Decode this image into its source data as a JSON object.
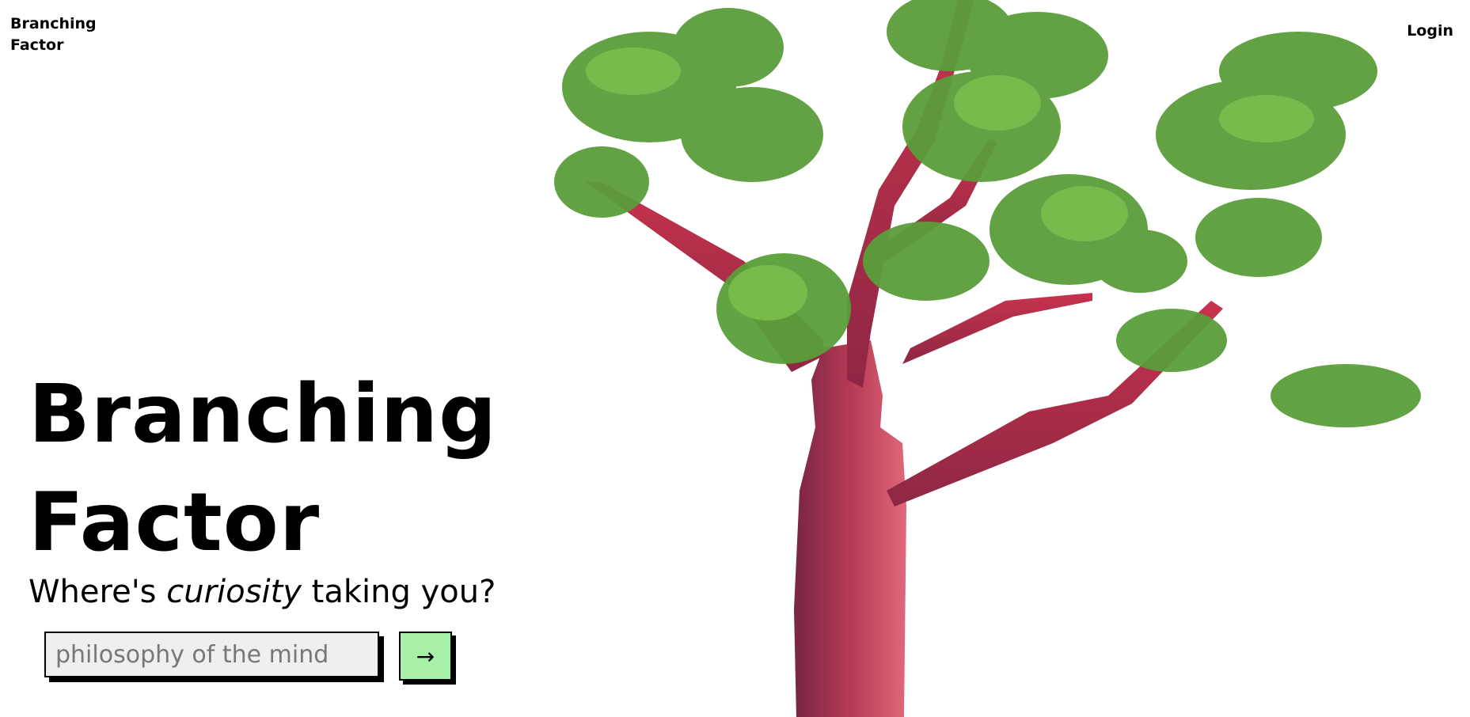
{
  "header": {
    "logo": "Branching\nFactor",
    "login_label": "Login"
  },
  "hero": {
    "title_line1": "Branching",
    "title_line2": "Factor",
    "tagline_before": "Where's ",
    "tagline_emphasis": "curiosity",
    "tagline_after": " taking you?"
  },
  "search": {
    "placeholder": "philosophy of the mind",
    "value": "",
    "submit_icon": "→"
  },
  "colors": {
    "trunk": "#c9445d",
    "foliage": "#5a9e3a",
    "button": "#a8f0a8",
    "input": "#efefef"
  }
}
